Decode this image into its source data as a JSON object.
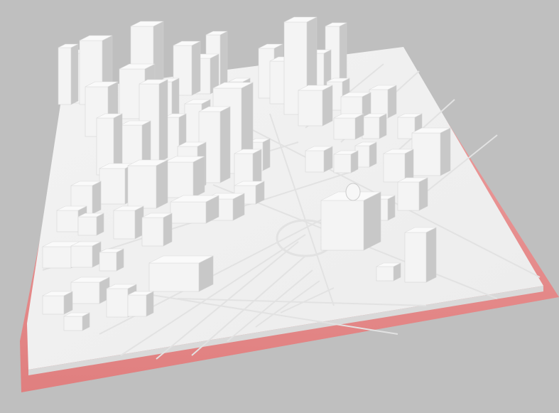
{
  "scene": {
    "background_color": "#bfbfbf",
    "base_plate_color": "#e58b8b",
    "model_color": "#f4f4f4",
    "street_color": "#e2e2e2",
    "shadow_color": "#c8c8c8"
  }
}
